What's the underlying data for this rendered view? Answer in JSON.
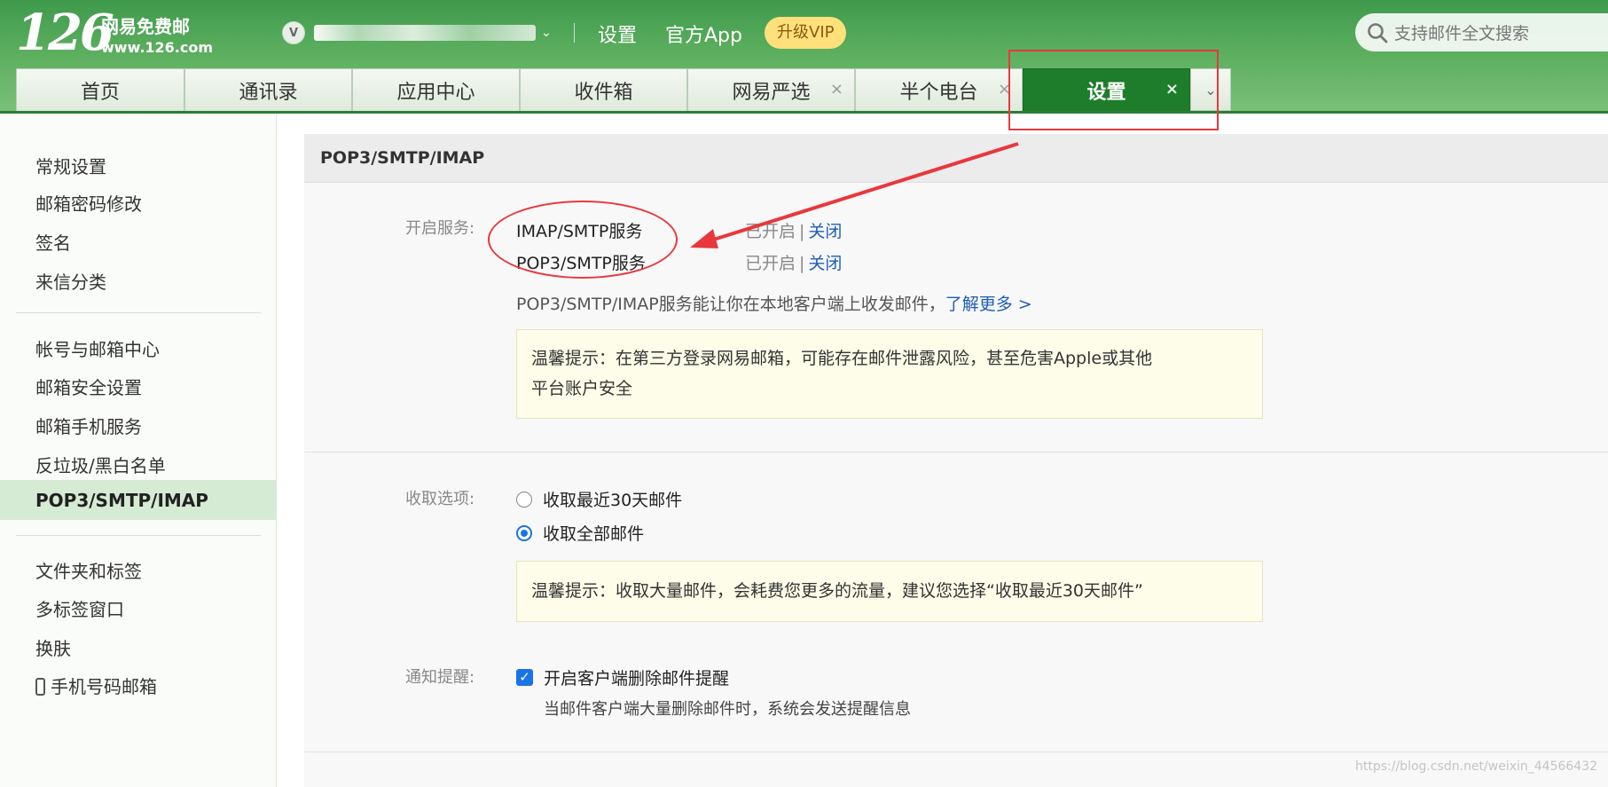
{
  "header": {
    "logo_number": "126",
    "logo_cn": "网易免费邮",
    "logo_url": "www.126.com",
    "account_badge": "V",
    "links": {
      "settings": "设置",
      "app": "官方App"
    },
    "vip_label": "升级VIP",
    "search_placeholder": "支持邮件全文搜索"
  },
  "tabs": [
    {
      "label": "首页"
    },
    {
      "label": "通讯录"
    },
    {
      "label": "应用中心"
    },
    {
      "label": "收件箱"
    },
    {
      "label": "网易严选",
      "close": "×"
    },
    {
      "label": "半个电台",
      "close": "×"
    },
    {
      "label": "设置",
      "close": "×",
      "active": true
    }
  ],
  "sidebar": {
    "group1": [
      "常规设置",
      "邮箱密码修改",
      "签名",
      "来信分类"
    ],
    "group2": [
      "帐号与邮箱中心",
      "邮箱安全设置",
      "邮箱手机服务",
      "反垃圾/黑白名单",
      "POP3/SMTP/IMAP"
    ],
    "group3": [
      "文件夹和标签",
      "多标签窗口",
      "换肤",
      "手机号码邮箱"
    ],
    "active_item": "POP3/SMTP/IMAP"
  },
  "main": {
    "section_title": "POP3/SMTP/IMAP",
    "service_label": "开启服务:",
    "services": [
      {
        "name": "IMAP/SMTP服务",
        "status": "已开启",
        "action": "关闭"
      },
      {
        "name": "POP3/SMTP服务",
        "status": "已开启",
        "action": "关闭"
      }
    ],
    "desc_text": "POP3/SMTP/IMAP服务能让你在本地客户端上收发邮件，",
    "learn_more": "了解更多 >",
    "tip1_line1": "温馨提示：在第三方登录网易邮箱，可能存在邮件泄露风险，甚至危害Apple或其他",
    "tip1_line2": "平台账户安全",
    "fetch_label": "收取选项:",
    "fetch_options": [
      {
        "label": "收取最近30天邮件",
        "selected": false
      },
      {
        "label": "收取全部邮件",
        "selected": true
      }
    ],
    "tip2": "温馨提示：收取大量邮件，会耗费您更多的流量，建议您选择“收取最近30天邮件”",
    "notify_label": "通知提醒:",
    "notify_option": {
      "label": "开启客户端删除邮件提醒",
      "checked": true
    },
    "notify_note": "当邮件客户端大量删除邮件时，系统会发送提醒信息"
  },
  "watermark": "https://blog.csdn.net/weixin_44566432",
  "colors": {
    "header_green": "#4aa453",
    "active_tab": "#1e7d2b",
    "link_blue": "#1f5db5",
    "annotation_red": "#e8383d",
    "tip_bg": "#fdfde9"
  }
}
